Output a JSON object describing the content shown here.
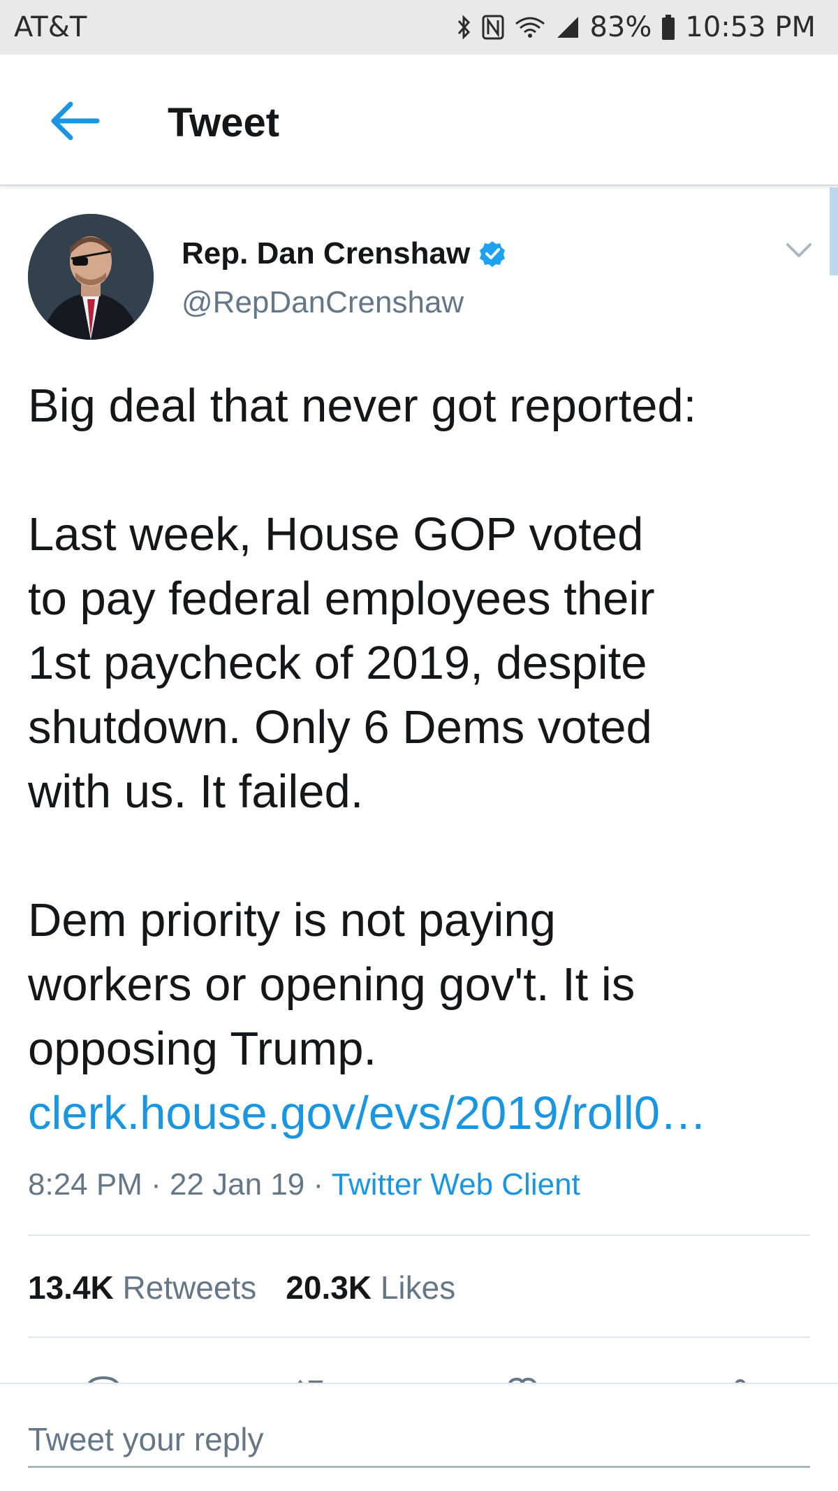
{
  "status_bar": {
    "carrier": "AT&T",
    "battery_percent": "83%",
    "time": "10:53 PM",
    "icons": [
      "bluetooth-icon",
      "nfc-icon",
      "wifi-icon",
      "signal-icon",
      "battery-icon"
    ]
  },
  "app_bar": {
    "title": "Tweet",
    "back_icon": "arrow-left-icon"
  },
  "tweet": {
    "author": {
      "name": "Rep. Dan Crenshaw",
      "handle": "@RepDanCrenshaw",
      "verified": true
    },
    "text": {
      "p1": "Big deal that never got reported:",
      "p2_l1": "Last week, House GOP voted",
      "p2_l2": "to pay federal employees their",
      "p2_l3": "1st paycheck of 2019, despite",
      "p2_l4": "shutdown. Only 6 Dems voted",
      "p2_l5": "with us. It failed.",
      "p3_l1": "Dem priority is not paying",
      "p3_l2": "workers or opening gov't. It is",
      "p3_l3": "opposing Trump.",
      "link": "clerk.house.gov/evs/2019/roll0…"
    },
    "meta": {
      "time": "8:24 PM",
      "date": "22 Jan 19",
      "separator": " · ",
      "client": "Twitter Web Client"
    },
    "stats": {
      "retweets_count": "13.4K",
      "retweets_label": "Retweets",
      "likes_count": "20.3K",
      "likes_label": "Likes"
    }
  },
  "reply": {
    "placeholder": "Tweet your reply"
  },
  "colors": {
    "accent": "#1b95e0",
    "text": "#14171a",
    "secondary": "#657786",
    "status_bar_bg": "#e9e9e9"
  }
}
